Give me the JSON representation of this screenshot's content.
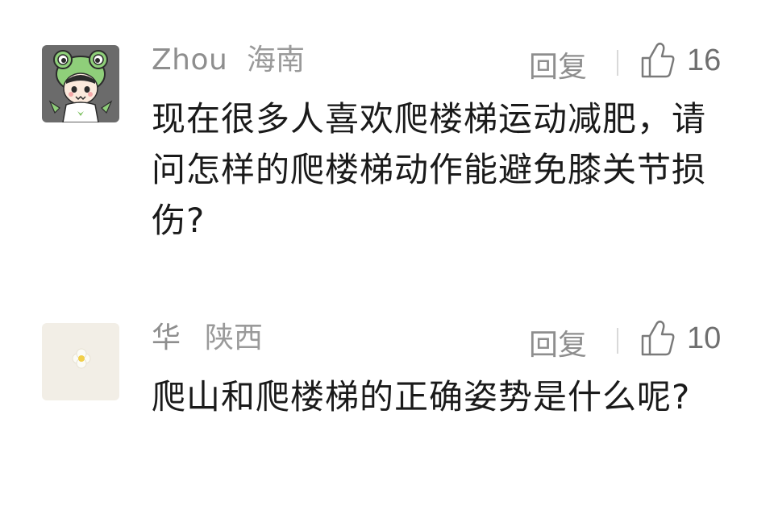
{
  "comments": [
    {
      "username": "Zhou",
      "location": "海南",
      "reply_label": "回复",
      "like_count": "16",
      "content": "现在很多人喜欢爬楼梯运动减肥，请问怎样的爬楼梯动作能避免膝关节损伤?",
      "avatar": "cartoon-frog-hat-avatar"
    },
    {
      "username": "华",
      "location": "陕西",
      "reply_label": "回复",
      "like_count": "10",
      "content": "爬山和爬楼梯的正确姿势是什么呢?",
      "avatar": "flower-avatar"
    }
  ],
  "colors": {
    "username": "#8e8e8e",
    "content": "#1a1a1a",
    "divider": "#d9d9d9"
  }
}
